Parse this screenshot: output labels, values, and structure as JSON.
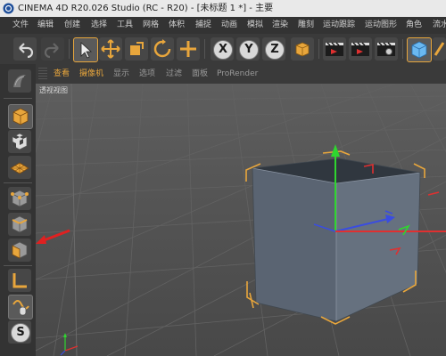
{
  "window": {
    "title": "CINEMA 4D R20.026 Studio (RC - R20) - [未标题 1 *] - 主要"
  },
  "menu": [
    "文件",
    "编辑",
    "创建",
    "选择",
    "工具",
    "网格",
    "体积",
    "捕捉",
    "动画",
    "模拟",
    "渲染",
    "雕刻",
    "运动跟踪",
    "运动图形",
    "角色",
    "流水"
  ],
  "toolbar": {
    "icons": [
      "undo-icon",
      "redo-icon",
      "select-cursor-icon",
      "move-icon",
      "scale-icon",
      "rotate-icon",
      "add-object-icon",
      "x-axis-lock-icon",
      "y-axis-lock-icon",
      "z-axis-lock-icon",
      "coordinate-system-icon",
      "render-view-icon",
      "render-picture-queue-icon",
      "render-settings-icon",
      "view-cube-icon",
      "edit-icon"
    ],
    "axis_x": "X",
    "axis_y": "Y",
    "axis_z": "Z"
  },
  "sidebar": {
    "icons": [
      "make-editable-icon",
      "model-mode-icon",
      "texture-mode-icon",
      "workplane-mode-icon",
      "points-mode-icon",
      "edges-mode-icon",
      "polygons-mode-icon",
      "enable-axis-icon",
      "tweak-mode-icon",
      "snap-icon"
    ],
    "snap_label": "S"
  },
  "viewport_menu": [
    "查看",
    "摄像机",
    "显示",
    "选项",
    "过滤",
    "面板",
    "ProRender"
  ],
  "viewport": {
    "label": "透视视图"
  },
  "colors": {
    "accent_orange": "#e8a63c",
    "axis_red": "#e03030",
    "axis_green": "#2fd62f",
    "axis_blue": "#3a4de0",
    "annotation_arrow": "#e02020"
  }
}
